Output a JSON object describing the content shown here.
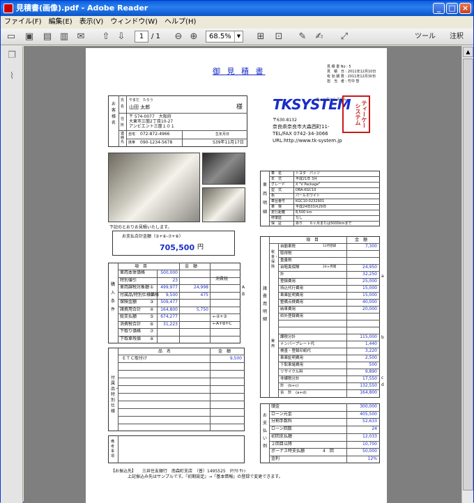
{
  "window": {
    "title": "見積書(画像).pdf - Adobe Reader",
    "minimize": "_",
    "maximize": "□",
    "close": "×"
  },
  "menu": [
    "ファイル(F)",
    "編集(E)",
    "表示(V)",
    "ウィンドウ(W)",
    "ヘルプ(H)"
  ],
  "toolbar": {
    "page": "1",
    "page_total": "/ 1",
    "zoom": "68.5%",
    "tools": "ツール",
    "comment": "注釈"
  },
  "doc": {
    "title": "御 見 積 書",
    "meta": [
      "見 積 書 No : 5",
      "見　積　日 : 2011年12月10日",
      "有 効 期 限 : 2011年12月30日",
      "担　当　者 : 竹中 智"
    ],
    "customer_label": "お客様名",
    "name_label": "氏名",
    "addr_label": "住所",
    "contact_label": "連絡先",
    "furigana": "やまだ　たろう",
    "name": "山田 太郎",
    "sama": "様",
    "zip": "〒 574-0077　大阪府",
    "addr1": "大東市三箇2丁目10-27",
    "addr2": "アンビエント三箇１０１",
    "home_label": "自宅",
    "home": "072-872-4966",
    "birth_label": "生年月日",
    "mobile_label": "携帯",
    "mobile": "090-1234-5678",
    "birth": "S39年11月17日",
    "company_logo": "TKSYSTEM",
    "company_kana": "ティーケーシステム",
    "company_zip": "〒630-8132",
    "company_addr": "奈良県奈良市大森西町11-",
    "company_tel": "TEL/FAX 0742-34-3066",
    "company_url": "URL:http://www.tk-system.jp",
    "stamp": "ティーケーシステム",
    "vehicle_label": "車両明細",
    "vehicle": [
      [
        "車　名",
        "トヨタ　パッソ"
      ],
      [
        "年　式",
        "平成21年 3月"
      ],
      [
        "グレード",
        "X \"V Package\""
      ],
      [
        "型　式",
        "DBA-KGC10"
      ],
      [
        "色",
        "パールホワイト"
      ],
      [
        "車台番号",
        "KGC10-0232901"
      ],
      [
        "車　検",
        "平成24年03月29日"
      ],
      [
        "走行距離",
        "8,500 km"
      ],
      [
        "修復歴",
        "なし"
      ],
      [
        "保　証",
        "あり　　６ヶ月または5000kmまで"
      ]
    ],
    "intro": "下記のとおりお見積いたします。",
    "total_label": "お支払合計金額（⑤+⑥-⑦+⑧）",
    "total": "705,500",
    "yen": "円",
    "buy_label": "購入条件",
    "col_item": "項　目",
    "col_amount": "金　額",
    "tax_col": "消費税",
    "buy": [
      [
        "車両本体価格",
        "",
        "500,000",
        ""
      ],
      [
        "特別値引",
        "",
        "23",
        ""
      ],
      [
        "車両課税対象額",
        "①",
        "499,977",
        "24,998"
      ],
      [
        "付属品/特別仕様価格",
        "②",
        "9,500",
        "475"
      ],
      [
        "保険金額",
        "③",
        "509,477",
        ""
      ],
      [
        "諸費用合計",
        "④",
        "164,800",
        "5,750"
      ],
      [
        "総支払額",
        "⑤",
        "674,277",
        ""
      ],
      [
        "消費税合計",
        "⑥",
        "31,223",
        ""
      ],
      [
        "下取り価格",
        "⑦",
        "",
        ""
      ],
      [
        "下取車残債",
        "⑧",
        "",
        ""
      ]
    ],
    "tax_marks": [
      "A",
      "B",
      "←②+③",
      "←A+B+C"
    ],
    "acc_label": "付属品・特別仕様",
    "acc_col_item": "品　名",
    "acc_col_amount": "金　額",
    "acc": [
      [
        "ＥＴＣ取付け",
        "9,500"
      ]
    ],
    "remarks_label": "備考事項",
    "bank": "【お振込先】　　三井住友銀行　南森町支店　（普）1495525　ﾀｹﾅｶ ｻﾄｼ",
    "bank_note": "上記振込み先はサンプルです。『初期設定』→『基本情報』の登録で変更できます。",
    "fees_label": "諸費用明細",
    "fees_col_item": "項　目",
    "fees_col_amount": "金　額",
    "tax_group": "税金・保険",
    "fees_group": "費用",
    "fees": [
      [
        "自動車税",
        "12月登録",
        "7,300"
      ],
      [
        "取得税",
        "",
        ""
      ],
      [
        "重量税",
        "",
        ""
      ],
      [
        "自賠責保険",
        "24ヶ月間",
        "24,950"
      ],
      [
        "計",
        "",
        "32,250"
      ],
      [
        "登録費用",
        "",
        "25,000"
      ],
      [
        "持込代行費用",
        "",
        "15,000"
      ],
      [
        "車庫証明費用",
        "",
        "15,000"
      ],
      [
        "整備点検費用",
        "",
        "40,000"
      ],
      [
        "納車費用",
        "",
        "20,000"
      ],
      [
        "県外登録費用",
        "",
        ""
      ],
      [
        "",
        "",
        ""
      ],
      [
        "",
        "",
        ""
      ],
      [
        "課税分計",
        "",
        "115,000"
      ],
      [
        "ナンバープレート代",
        "",
        "1,440"
      ],
      [
        "検査・登録印紙代",
        "",
        "3,220"
      ],
      [
        "車庫証明費用",
        "",
        "2,500"
      ],
      [
        "下取車諸費用",
        "",
        "500"
      ],
      [
        "リサイクル料",
        "",
        "9,890"
      ],
      [
        "非課税分計",
        "",
        "17,550"
      ],
      [
        "計　(b+c)",
        "",
        "132,550"
      ],
      [
        "合　計　(a+d)",
        "",
        "164,800"
      ]
    ],
    "fee_marks": [
      "a",
      "b",
      "c",
      "d"
    ],
    "pay_label": "お支払い例",
    "pay": [
      [
        "頭金",
        "",
        "300,000"
      ],
      [
        "ローン元金",
        "",
        "405,500"
      ],
      [
        "分割手数料",
        "",
        "52,633"
      ],
      [
        "ローン回数",
        "",
        "24"
      ],
      [
        "初回支払額",
        "",
        "12,033"
      ],
      [
        "２回目以降",
        "",
        "10,700"
      ],
      [
        "ボーナス時支払額",
        "4　回",
        "50,000"
      ],
      [
        "金利",
        "",
        "12%"
      ]
    ]
  }
}
